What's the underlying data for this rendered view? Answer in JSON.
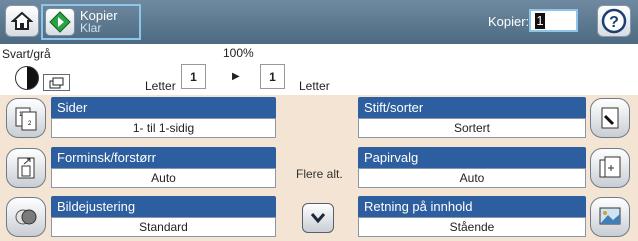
{
  "header": {
    "status_title": "Kopier",
    "status_sub": "Klar",
    "copies_label": "Kopier:",
    "copies_value": "1",
    "icons": {
      "home": "home-icon",
      "start": "start-copy-icon",
      "help": "help-icon"
    }
  },
  "settings_row": {
    "color_mode": "Svart/grå",
    "zoom": "100%",
    "paper_in": "Letter",
    "paper_out": "Letter",
    "tray_in": "1",
    "tray_out": "1"
  },
  "options": [
    {
      "title": "Sider",
      "value": "1- til 1-sidig",
      "icon": "pages-icon"
    },
    {
      "title": "Forminsk/forstørr",
      "value": "Auto",
      "icon": "resize-icon"
    },
    {
      "title": "Bildejustering",
      "value": "Standard",
      "icon": "image-adjust-icon"
    },
    {
      "title": "Stift/sorter",
      "value": "Sortert",
      "icon": "staple-icon"
    },
    {
      "title": "Papirvalg",
      "value": "Auto",
      "icon": "paper-select-icon"
    },
    {
      "title": "Retning på innhold",
      "value": "Stående",
      "icon": "orientation-icon"
    }
  ],
  "more_options": "Flere alt.",
  "colors": {
    "accent": "#2d5fa0",
    "topbar": "#5a768d",
    "panel": "#f3e4d4"
  }
}
